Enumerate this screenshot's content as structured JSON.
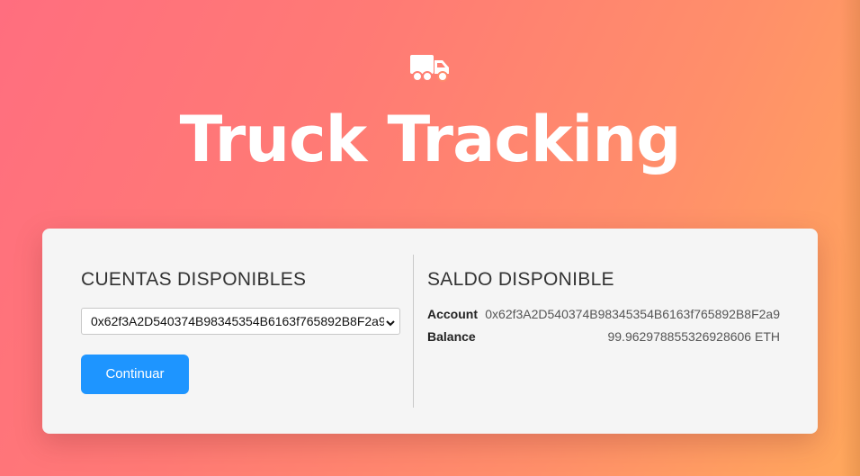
{
  "header": {
    "icon": "truck-icon",
    "title": "Truck Tracking"
  },
  "accounts_panel": {
    "title": "CUENTAS DISPONIBLES",
    "selected_account": "0x62f3A2D540374B98345354B6163f765892B8F2a9",
    "continue_label": "Continuar"
  },
  "balance_panel": {
    "title": "SALDO DISPONIBLE",
    "account_label": "Account",
    "account_value": "0x62f3A2D540374B98345354B6163f765892B8F2a9",
    "balance_label": "Balance",
    "balance_value": "99.962978855326928606 ETH"
  },
  "colors": {
    "gradient_start": "#ff6e7f",
    "gradient_end": "#ffa85c",
    "card_background": "#f5f5f5",
    "button": "#1e95ff"
  }
}
